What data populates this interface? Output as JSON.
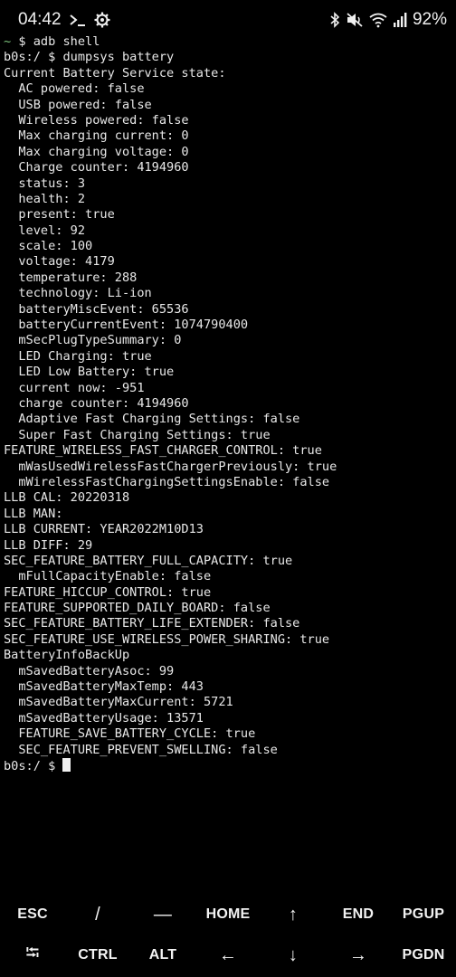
{
  "statusbar": {
    "time": "04:42",
    "battery_percent": "92%",
    "left_icons": [
      "terminal-prompt-icon",
      "settings-gear-icon"
    ],
    "right_icons": [
      "bluetooth-icon",
      "mute-icon",
      "wifi-icon",
      "signal-icon"
    ]
  },
  "terminal": {
    "lines": [
      "~ $ adb shell",
      "b0s:/ $ dumpsys battery",
      "Current Battery Service state:",
      "  AC powered: false",
      "  USB powered: false",
      "  Wireless powered: false",
      "  Max charging current: 0",
      "  Max charging voltage: 0",
      "  Charge counter: 4194960",
      "  status: 3",
      "  health: 2",
      "  present: true",
      "  level: 92",
      "  scale: 100",
      "  voltage: 4179",
      "  temperature: 288",
      "  technology: Li-ion",
      "  batteryMiscEvent: 65536",
      "  batteryCurrentEvent: 1074790400",
      "  mSecPlugTypeSummary: 0",
      "  LED Charging: true",
      "  LED Low Battery: true",
      "  current now: -951",
      "  charge counter: 4194960",
      "  Adaptive Fast Charging Settings: false",
      "  Super Fast Charging Settings: true",
      "FEATURE_WIRELESS_FAST_CHARGER_CONTROL: true",
      "  mWasUsedWirelessFastChargerPreviously: true",
      "  mWirelessFastChargingSettingsEnable: false",
      "LLB CAL: 20220318",
      "LLB MAN:",
      "LLB CURRENT: YEAR2022M10D13",
      "LLB DIFF: 29",
      "SEC_FEATURE_BATTERY_FULL_CAPACITY: true",
      "  mFullCapacityEnable: false",
      "FEATURE_HICCUP_CONTROL: true",
      "FEATURE_SUPPORTED_DAILY_BOARD: false",
      "SEC_FEATURE_BATTERY_LIFE_EXTENDER: false",
      "SEC_FEATURE_USE_WIRELESS_POWER_SHARING: true",
      "BatteryInfoBackUp",
      "  mSavedBatteryAsoc: 99",
      "  mSavedBatteryMaxTemp: 443",
      "  mSavedBatteryMaxCurrent: 5721",
      "  mSavedBatteryUsage: 13571",
      "  FEATURE_SAVE_BATTERY_CYCLE: true",
      "  SEC_FEATURE_PREVENT_SWELLING: false"
    ],
    "prompt": "b0s:/ $ "
  },
  "extra_keys": {
    "row1": [
      "ESC",
      "/",
      "—",
      "HOME",
      "↑",
      "END",
      "PGUP"
    ],
    "row2": [
      "⭾",
      "CTRL",
      "ALT",
      "←",
      "↓",
      "→",
      "PGDN"
    ]
  }
}
